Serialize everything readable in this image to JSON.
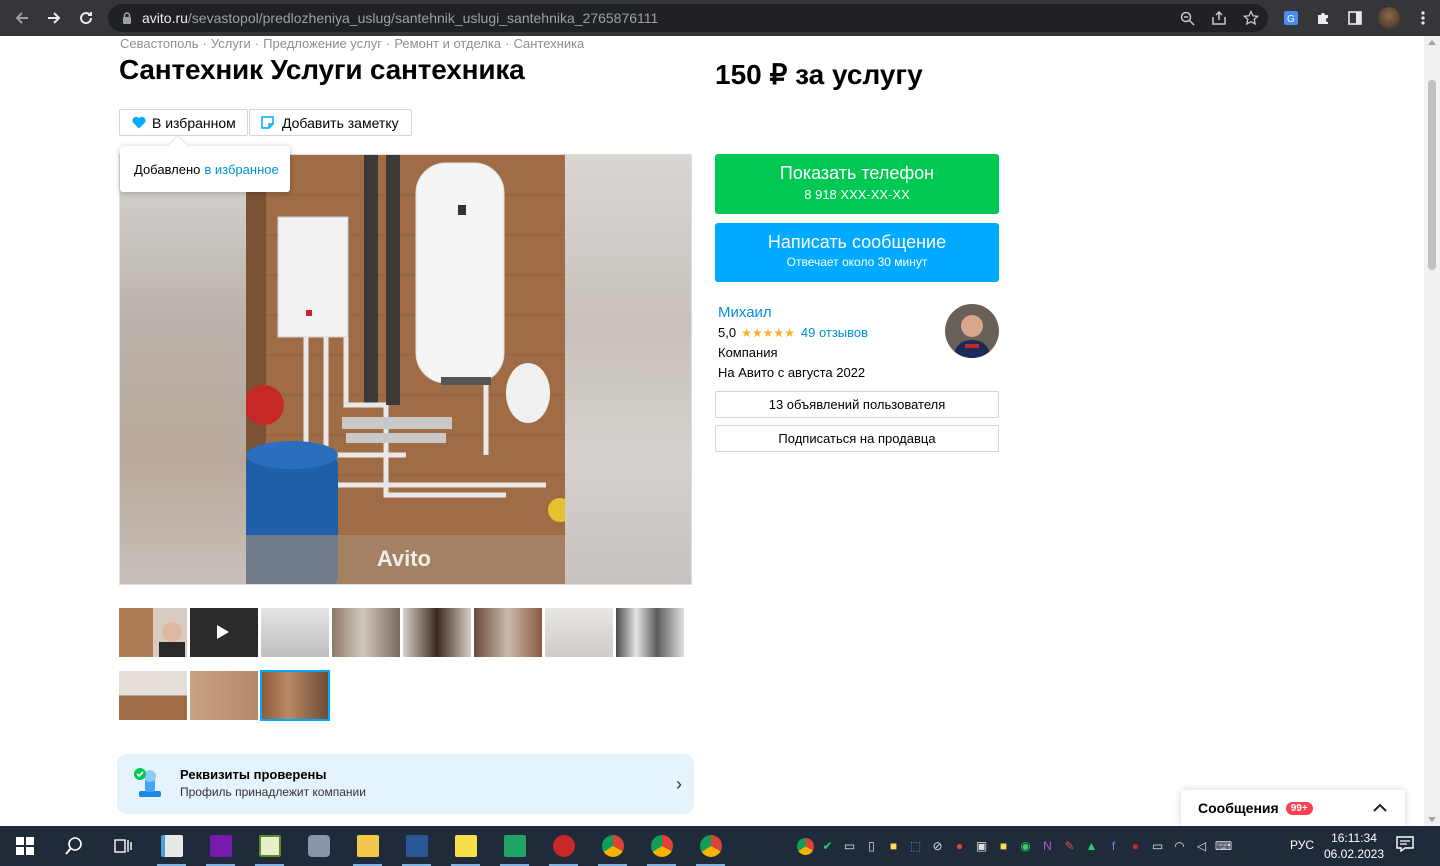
{
  "browser": {
    "url_host": "avito.ru",
    "url_path": "/sevastopol/predlozheniya_uslug/santehnik_uslugi_santehnika_2765876111"
  },
  "breadcrumb": [
    "Севастополь",
    "Услуги",
    "Предложение услуг",
    "Ремонт и отделка",
    "Сантехника"
  ],
  "listing": {
    "title": "Сантехник Услуги сантехника",
    "price": "150 ₽ за услугу",
    "fav_label": "В избранном",
    "note_label": "Добавить заметку",
    "tooltip_text": "Добавлено",
    "tooltip_link": "в избранное",
    "watermark": "Avito"
  },
  "contact": {
    "phone_label": "Показать телефон",
    "phone_number": "8 918 XXX-XX-XX",
    "message_label": "Написать сообщение",
    "message_sub": "Отвечает около 30 минут"
  },
  "seller": {
    "name": "Михаил",
    "rating": "5,0",
    "stars": "★★★★★",
    "reviews": "49 отзывов",
    "type": "Компания",
    "since": "На Авито с августа 2022",
    "ads_button": "13 объявлений пользователя",
    "subscribe_button": "Подписаться на продавца"
  },
  "verified": {
    "title": "Реквизиты проверены",
    "subtitle": "Профиль принадлежит компании",
    "chevron": "›"
  },
  "messages": {
    "label": "Сообщения",
    "badge": "99+",
    "caret": "⌃"
  },
  "taskbar": {
    "lang": "РУС",
    "time": "16:11:34",
    "date": "06.02.2023"
  },
  "colors": {
    "green": "#00c853",
    "blue": "#00aaff",
    "link": "#0091d9",
    "star": "#ffb021",
    "verified_bg": "#e5f3fd"
  }
}
